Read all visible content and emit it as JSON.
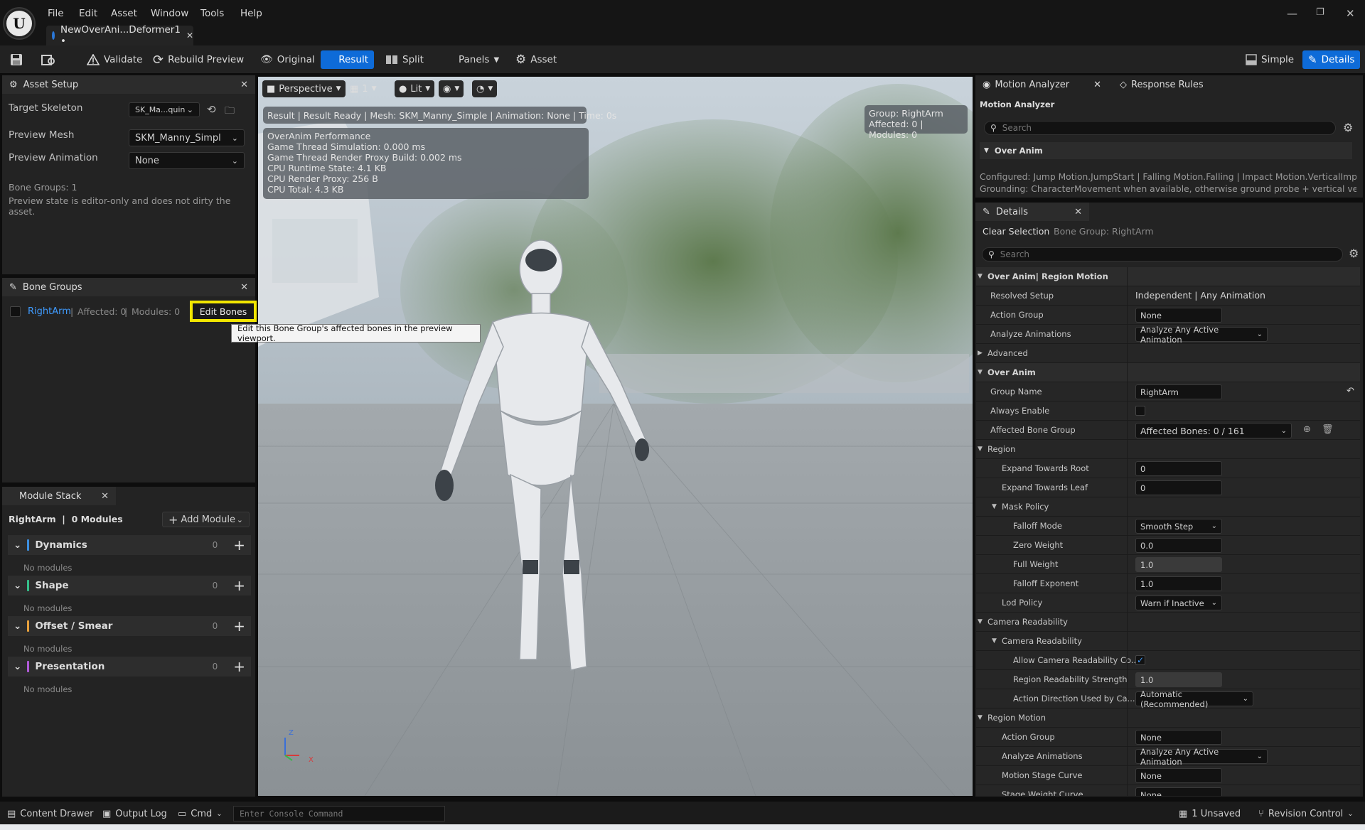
{
  "menu": [
    "File",
    "Edit",
    "Asset",
    "Window",
    "Tools",
    "Help"
  ],
  "document_tab": {
    "title": "NewOverAni...Deformer1 •"
  },
  "toolbar": {
    "validate": "Validate",
    "rebuild": "Rebuild Preview",
    "original": "Original",
    "result": "Result",
    "split": "Split",
    "panels": "Panels",
    "asset": "Asset",
    "simple": "Simple",
    "details": "Details"
  },
  "asset_setup": {
    "tab": "Asset Setup",
    "target_skeleton_label": "Target Skeleton",
    "target_skeleton_value": "SK_Ma...quin",
    "preview_mesh_label": "Preview Mesh",
    "preview_mesh_value": "SKM_Manny_Simple",
    "preview_animation_label": "Preview Animation",
    "preview_animation_value": "None",
    "bone_groups_count": "Bone Groups: 1",
    "note": "Preview state is editor-only and does not dirty the asset."
  },
  "bone_groups": {
    "tab": "Bone Groups",
    "item_name": "RightArm",
    "item_sep": "|",
    "item_affected": "Affected: 0",
    "item_modules": "Modules: 0",
    "edit_bones": "Edit Bones",
    "tooltip": "Edit this Bone Group's affected bones in the preview viewport."
  },
  "module_stack": {
    "tab": "Module Stack",
    "header": "RightArm  |  0 Modules",
    "add_module": "Add Module",
    "groups": [
      {
        "name": "Dynamics",
        "count": "0",
        "empty": "No modules",
        "color": "#3c8fe0"
      },
      {
        "name": "Shape",
        "count": "0",
        "empty": "No modules",
        "color": "#35c08a"
      },
      {
        "name": "Offset / Smear",
        "count": "0",
        "empty": "No modules",
        "color": "#e8a13c"
      },
      {
        "name": "Presentation",
        "count": "0",
        "empty": "No modules",
        "color": "#b05ad8"
      }
    ]
  },
  "viewport": {
    "perspective": "Perspective",
    "lit": "Lit",
    "cam_count": "1",
    "result_banner": "Result | Result Ready | Mesh: SKM_Manny_Simple | Animation: None | Time: 0s",
    "perf_title": "OverAnim Performance",
    "perf_lines": [
      "Game Thread Simulation: 0.000 ms",
      "Game Thread Render Proxy Build: 0.002 ms",
      "CPU Runtime State: 4.1 KB",
      "CPU Render Proxy: 256 B",
      "CPU Total: 4.3 KB"
    ],
    "group_line1": "Group: RightArm",
    "group_line2": "Affected: 0 | Modules: 0",
    "axis_z": "Z",
    "axis_x": "X"
  },
  "motion_analyzer": {
    "tab": "Motion Analyzer",
    "tab2": "Response Rules",
    "header": "Motion Analyzer",
    "search": "Search",
    "section": "Over Anim",
    "configured": "Configured: Jump Motion.JumpStart | Falling Motion.Falling | Impact Motion.VerticalImpact | S",
    "grounding": "Grounding: CharacterMovement when available, otherwise ground probe + vertical velocity th"
  },
  "details": {
    "tab": "Details",
    "clear_selection": "Clear Selection",
    "selection": "Bone Group: RightArm",
    "search": "Search",
    "rows": [
      {
        "label": "Over Anim| Region Motion",
        "kind": "cat",
        "indent": 0
      },
      {
        "label": "Resolved Setup",
        "kind": "text",
        "value": "Independent | Any Animation",
        "indent": 1
      },
      {
        "label": "Action Group",
        "kind": "box",
        "value": "None",
        "indent": 1
      },
      {
        "label": "Analyze Animations",
        "kind": "dd",
        "value": "Analyze Any Active Animation",
        "indent": 1,
        "w": 186
      },
      {
        "label": "Advanced",
        "kind": "sub",
        "indent": 0,
        "closed": true
      },
      {
        "label": "Over Anim",
        "kind": "cat",
        "indent": 0
      },
      {
        "label": "Group Name",
        "kind": "box",
        "value": "RightArm",
        "indent": 1,
        "reset": true
      },
      {
        "label": "Always Enable",
        "kind": "check",
        "checked": false,
        "indent": 1
      },
      {
        "label": "Affected Bone Group",
        "kind": "dd",
        "value": "Affected Bones: 0 / 161",
        "indent": 1,
        "w": 220,
        "extra": true
      },
      {
        "label": "Region",
        "kind": "sub",
        "indent": 0
      },
      {
        "label": "Expand Towards Root",
        "kind": "box",
        "value": "0",
        "indent": 2
      },
      {
        "label": "Expand Towards Leaf",
        "kind": "box",
        "value": "0",
        "indent": 2
      },
      {
        "label": "Mask Policy",
        "kind": "sub",
        "indent": 2
      },
      {
        "label": "Falloff Mode",
        "kind": "dd",
        "value": "Smooth Step",
        "indent": 3,
        "w": 122
      },
      {
        "label": "Zero Weight",
        "kind": "box",
        "value": "0.0",
        "indent": 3
      },
      {
        "label": "Full Weight",
        "kind": "box",
        "value": "1.0",
        "indent": 3,
        "gray": true
      },
      {
        "label": "Falloff Exponent",
        "kind": "box",
        "value": "1.0",
        "indent": 3
      },
      {
        "label": "Lod Policy",
        "kind": "dd",
        "value": "Warn if Inactive",
        "indent": 2,
        "w": 122
      },
      {
        "label": "Camera Readability",
        "kind": "sub",
        "indent": 0
      },
      {
        "label": "Camera Readability",
        "kind": "sub",
        "indent": 2
      },
      {
        "label": "Allow Camera Readability Co...",
        "kind": "check",
        "checked": true,
        "indent": 3
      },
      {
        "label": "Region Readability Strength",
        "kind": "box",
        "value": "1.0",
        "indent": 3,
        "gray": true
      },
      {
        "label": "Action Direction Used by Ca...",
        "kind": "dd",
        "value": "Automatic (Recommended)",
        "indent": 3,
        "w": 166
      },
      {
        "label": "Region Motion",
        "kind": "sub",
        "indent": 0
      },
      {
        "label": "Action Group",
        "kind": "box",
        "value": "None",
        "indent": 2
      },
      {
        "label": "Analyze Animations",
        "kind": "dd",
        "value": "Analyze Any Active Animation",
        "indent": 2,
        "w": 186
      },
      {
        "label": "Motion Stage Curve",
        "kind": "box",
        "value": "None",
        "indent": 2
      },
      {
        "label": "Stage Weight Curve",
        "kind": "box",
        "value": "None",
        "indent": 2
      }
    ]
  },
  "statusbar": {
    "content_drawer": "Content Drawer",
    "output_log": "Output Log",
    "cmd": "Cmd",
    "console_placeholder": "Enter Console Command",
    "unsaved": "1 Unsaved",
    "revision": "Revision Control"
  },
  "colors": {
    "accent": "#0e6bd8",
    "highlight": "#f2e600"
  }
}
